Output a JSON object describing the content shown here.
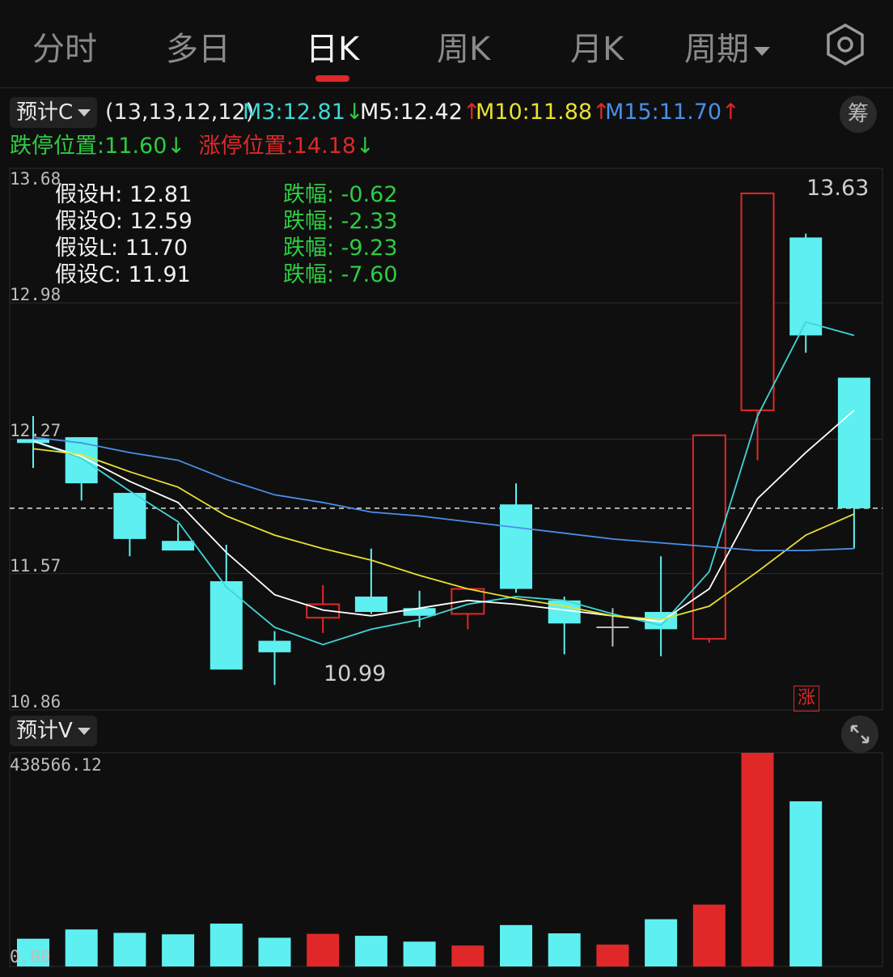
{
  "tabs": [
    {
      "label": "分时",
      "active": false
    },
    {
      "label": "多日",
      "active": false
    },
    {
      "label": "日K",
      "active": true
    },
    {
      "label": "周K",
      "active": false
    },
    {
      "label": "月K",
      "active": false
    },
    {
      "label": "周期",
      "active": false
    }
  ],
  "info": {
    "forecast_label": "预计C",
    "params": "(13,13,12,12)",
    "m3": "M3:12.81",
    "m5": "M5:12.42",
    "m10": "M10:11.88",
    "m15": "M15:11.70",
    "down_arrow": "↓",
    "up_arrow": "↑",
    "chou_label": "筹",
    "limit_down": "跌停位置:11.60",
    "limit_up": "涨停位置:14.18"
  },
  "hypothesis": [
    {
      "label": "假设H: 12.81",
      "change": "跌幅: -0.62"
    },
    {
      "label": "假设O: 12.59",
      "change": "跌幅: -2.33"
    },
    {
      "label": "假设L: 11.70",
      "change": "跌幅: -9.23"
    },
    {
      "label": "假设C: 11.91",
      "change": "跌幅: -7.60"
    }
  ],
  "price_axis": {
    "top": "13.68",
    "l2": "12.98",
    "l3": "12.27",
    "l4": "11.57",
    "bottom": "10.86"
  },
  "annotations": {
    "high": "13.63",
    "low": "10.99",
    "zhang": "涨"
  },
  "volume": {
    "label": "预计V",
    "max": "438566.12",
    "zero": "0.00"
  },
  "colors": {
    "up": "#e02828",
    "down": "#5ef0f0",
    "m3": "#40d6d6",
    "m5": "#ffffff",
    "m10": "#e8e030",
    "m15": "#4a8fe8"
  },
  "chart_data": {
    "type": "candlestick",
    "ylim": [
      10.86,
      13.68
    ],
    "candles": [
      {
        "open": 12.27,
        "close": 12.25,
        "high": 12.39,
        "low": 12.12,
        "dir": "down"
      },
      {
        "open": 12.28,
        "close": 12.04,
        "high": 12.28,
        "low": 11.95,
        "dir": "down"
      },
      {
        "open": 11.99,
        "close": 11.75,
        "high": 11.99,
        "low": 11.66,
        "dir": "down"
      },
      {
        "open": 11.74,
        "close": 11.69,
        "high": 11.83,
        "low": 11.69,
        "dir": "down"
      },
      {
        "open": 11.53,
        "close": 11.07,
        "high": 11.72,
        "low": 11.07,
        "dir": "down"
      },
      {
        "open": 11.22,
        "close": 11.16,
        "high": 11.27,
        "low": 10.99,
        "dir": "down"
      },
      {
        "open": 11.34,
        "close": 11.41,
        "high": 11.51,
        "low": 11.26,
        "dir": "up"
      },
      {
        "open": 11.45,
        "close": 11.37,
        "high": 11.7,
        "low": 11.36,
        "dir": "down"
      },
      {
        "open": 11.39,
        "close": 11.35,
        "high": 11.48,
        "low": 11.29,
        "dir": "down"
      },
      {
        "open": 11.36,
        "close": 11.49,
        "high": 11.49,
        "low": 11.28,
        "dir": "up"
      },
      {
        "open": 11.93,
        "close": 11.49,
        "high": 12.04,
        "low": 11.47,
        "dir": "down"
      },
      {
        "open": 11.43,
        "close": 11.31,
        "high": 11.45,
        "low": 11.15,
        "dir": "down"
      },
      {
        "open": 11.29,
        "close": 11.29,
        "high": 11.39,
        "low": 11.19,
        "dir": "flat"
      },
      {
        "open": 11.37,
        "close": 11.28,
        "high": 11.66,
        "low": 11.14,
        "dir": "down"
      },
      {
        "open": 11.23,
        "close": 12.29,
        "high": 12.29,
        "low": 11.21,
        "dir": "up"
      },
      {
        "open": 12.42,
        "close": 13.55,
        "high": 13.55,
        "low": 12.16,
        "dir": "up"
      },
      {
        "open": 13.32,
        "close": 12.81,
        "high": 13.34,
        "low": 12.72,
        "dir": "down"
      },
      {
        "open": 12.59,
        "close": 11.91,
        "high": 12.59,
        "low": 11.7,
        "dir": "down"
      }
    ],
    "volume_ylim": [
      0,
      438566.12
    ],
    "volumes": [
      {
        "value": 57000,
        "dir": "down"
      },
      {
        "value": 76000,
        "dir": "down"
      },
      {
        "value": 69000,
        "dir": "down"
      },
      {
        "value": 66000,
        "dir": "down"
      },
      {
        "value": 88000,
        "dir": "down"
      },
      {
        "value": 59000,
        "dir": "down"
      },
      {
        "value": 67000,
        "dir": "up"
      },
      {
        "value": 63000,
        "dir": "down"
      },
      {
        "value": 51000,
        "dir": "down"
      },
      {
        "value": 43000,
        "dir": "up"
      },
      {
        "value": 85000,
        "dir": "down"
      },
      {
        "value": 68000,
        "dir": "down"
      },
      {
        "value": 45000,
        "dir": "up"
      },
      {
        "value": 97000,
        "dir": "down"
      },
      {
        "value": 127000,
        "dir": "up"
      },
      {
        "value": 438566,
        "dir": "up"
      },
      {
        "value": 339000,
        "dir": "down"
      }
    ],
    "ma": {
      "m3": [
        12.26,
        12.17,
        12.0,
        11.84,
        11.5,
        11.29,
        11.2,
        11.28,
        11.33,
        11.41,
        11.45,
        11.43,
        11.36,
        11.3,
        11.58,
        12.39,
        12.88,
        12.81
      ],
      "m5": [
        12.26,
        12.18,
        12.05,
        11.94,
        11.68,
        11.46,
        11.38,
        11.35,
        11.39,
        11.43,
        11.41,
        11.38,
        11.35,
        11.32,
        11.49,
        11.96,
        12.2,
        12.42
      ],
      "m10": [
        12.22,
        12.19,
        12.1,
        12.02,
        11.87,
        11.77,
        11.7,
        11.64,
        11.56,
        11.49,
        11.44,
        11.4,
        11.35,
        11.33,
        11.4,
        11.58,
        11.77,
        11.88
      ],
      "m15": [
        12.28,
        12.25,
        12.2,
        12.16,
        12.06,
        11.98,
        11.94,
        11.89,
        11.87,
        11.84,
        11.81,
        11.78,
        11.75,
        11.73,
        11.71,
        11.69,
        11.69,
        11.7
      ]
    },
    "current_price": 11.91
  }
}
